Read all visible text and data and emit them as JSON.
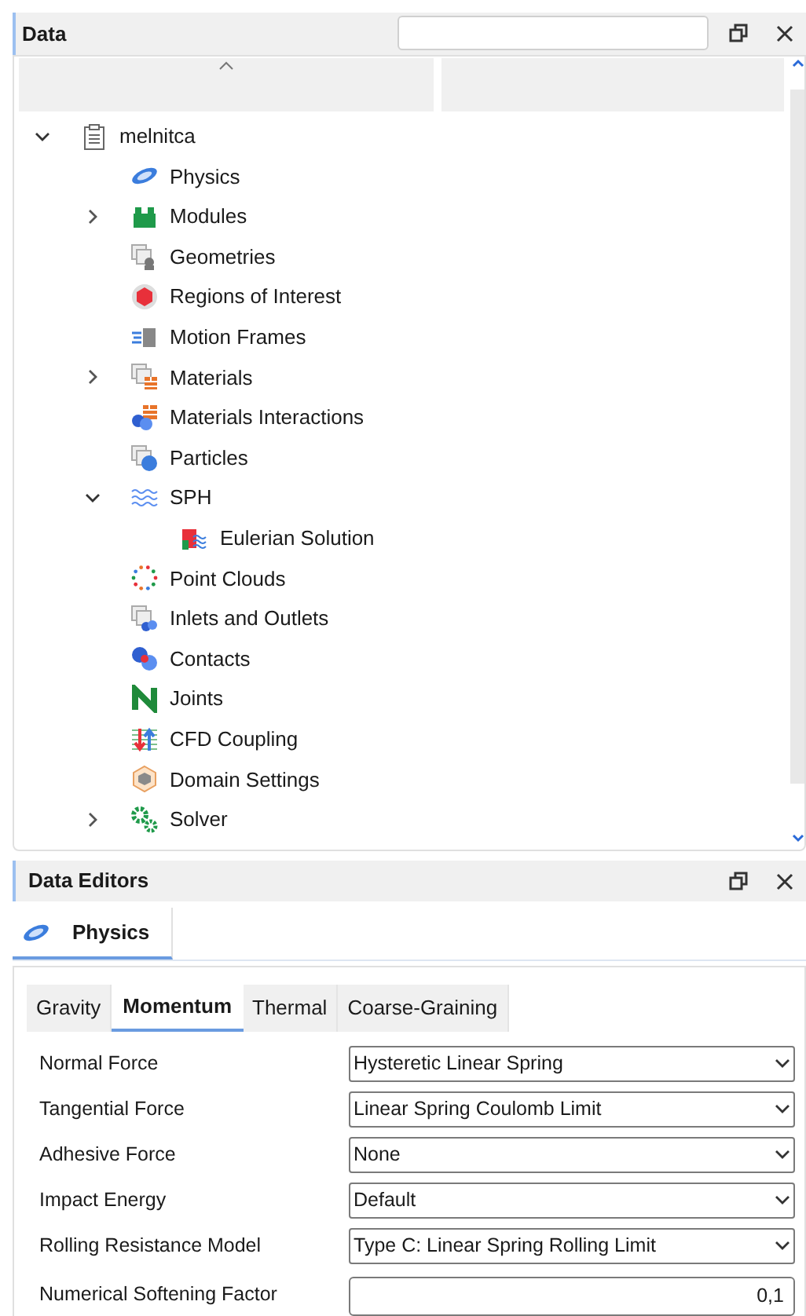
{
  "data_panel": {
    "title": "Data",
    "tree": [
      {
        "label": "melnitca",
        "kind": "document",
        "expanded": true,
        "children": [
          {
            "label": "Physics",
            "kind": "planet"
          },
          {
            "label": "Modules",
            "kind": "blocks",
            "expanded": false
          },
          {
            "label": "Geometries",
            "kind": "geometry"
          },
          {
            "label": "Regions of Interest",
            "kind": "region"
          },
          {
            "label": "Motion Frames",
            "kind": "motion"
          },
          {
            "label": "Materials",
            "kind": "material",
            "expanded": false
          },
          {
            "label": "Materials Interactions",
            "kind": "interaction"
          },
          {
            "label": "Particles",
            "kind": "particle"
          },
          {
            "label": "SPH",
            "kind": "waves",
            "expanded": true,
            "children": [
              {
                "label": "Eulerian Solution",
                "kind": "eulerian"
              }
            ]
          },
          {
            "label": "Point Clouds",
            "kind": "cloud"
          },
          {
            "label": "Inlets and Outlets",
            "kind": "inlet"
          },
          {
            "label": "Contacts",
            "kind": "contact"
          },
          {
            "label": "Joints",
            "kind": "joint"
          },
          {
            "label": "CFD Coupling",
            "kind": "cfd"
          },
          {
            "label": "Domain Settings",
            "kind": "domain"
          },
          {
            "label": "Solver",
            "kind": "gears",
            "expanded": false
          }
        ]
      }
    ]
  },
  "editor_panel": {
    "title": "Data Editors",
    "tabs": [
      {
        "label": "Physics",
        "selected": true
      }
    ],
    "subtabs": [
      {
        "label": "Gravity",
        "selected": false
      },
      {
        "label": "Momentum",
        "selected": true
      },
      {
        "label": "Thermal",
        "selected": false
      },
      {
        "label": "Coarse-Graining",
        "selected": false
      }
    ],
    "fields": [
      {
        "label": "Normal Force",
        "kind": "select",
        "value": "Hysteretic Linear Spring"
      },
      {
        "label": "Tangential Force",
        "kind": "select",
        "value": "Linear Spring Coulomb Limit"
      },
      {
        "label": "Adhesive Force",
        "kind": "select",
        "value": "None"
      },
      {
        "label": "Impact Energy",
        "kind": "select",
        "value": "Default"
      },
      {
        "label": "Rolling Resistance Model",
        "kind": "select",
        "value": "Type C: Linear Spring Rolling Limit"
      },
      {
        "label": "Numerical Softening Factor",
        "kind": "number",
        "value": "0,1"
      }
    ]
  }
}
